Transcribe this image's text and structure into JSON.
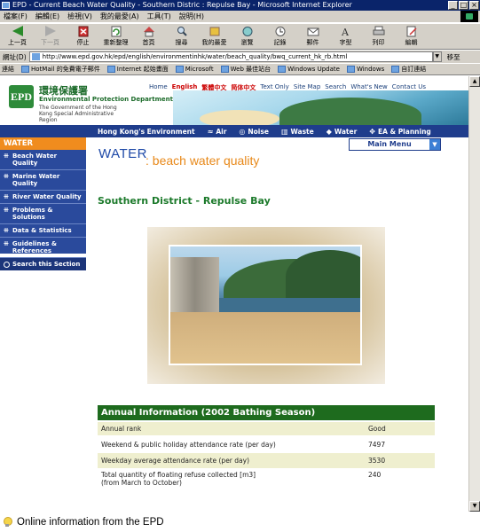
{
  "window": {
    "title": "EPD - Current Beach Water Quality - Southern Distric : Repulse Bay - Microsoft Internet Explorer",
    "buttons": [
      "_",
      "□",
      "×"
    ]
  },
  "menubar": [
    "檔案(F)",
    "編輯(E)",
    "檢視(V)",
    "我的最愛(A)",
    "工具(T)",
    "說明(H)"
  ],
  "toolbar": [
    {
      "label": "上一頁",
      "icon": "back-arrow-icon",
      "enabled": true
    },
    {
      "label": "下一頁",
      "icon": "forward-arrow-icon",
      "enabled": false
    },
    {
      "label": "停止",
      "icon": "stop-icon",
      "enabled": true
    },
    {
      "label": "重新整理",
      "icon": "refresh-icon",
      "enabled": true
    },
    {
      "label": "首頁",
      "icon": "home-icon",
      "enabled": true
    },
    {
      "label": "搜尋",
      "icon": "search-icon",
      "enabled": true
    },
    {
      "label": "我的最愛",
      "icon": "favorites-icon",
      "enabled": true
    },
    {
      "label": "瀏覽",
      "icon": "history-icon",
      "enabled": true
    },
    {
      "label": "記錄",
      "icon": "history-log-icon",
      "enabled": true
    },
    {
      "label": "郵件",
      "icon": "mail-icon",
      "enabled": true
    },
    {
      "label": "字型",
      "icon": "font-icon",
      "enabled": true
    },
    {
      "label": "列印",
      "icon": "print-icon",
      "enabled": true
    },
    {
      "label": "編輯",
      "icon": "edit-icon",
      "enabled": true
    }
  ],
  "address": {
    "label": "網址(D)",
    "url": "http://www.epd.gov.hk/epd/english/environmentinhk/water/beach_quality/bwq_current_hk_rb.html",
    "go_label": "移至"
  },
  "links": {
    "label": "連結",
    "items": [
      "HotMail 的免費電子郵件",
      "Internet 起始畫面",
      "Microsoft",
      "Web 最佳站台",
      "Windows Update",
      "Windows",
      "自訂連結"
    ]
  },
  "header": {
    "logo_text": "EPD",
    "name_cn": "環境保護署",
    "name_en": "Environmental Protection Department",
    "gov_text": "The Government of the Hong Kong Special Administrative Region",
    "top_links": [
      "Home",
      "English",
      "繁體中文",
      "简体中文",
      "Text Only",
      "Site Map",
      "Search",
      "What's New",
      "Contact Us"
    ]
  },
  "navbar": {
    "lead": "Hong Kong's Environment",
    "items": [
      "Air",
      "Noise",
      "Waste",
      "Water",
      "EA & Planning"
    ]
  },
  "sidebar": {
    "heading": "WATER",
    "items": [
      "Beach Water Quality",
      "Marine Water Quality",
      "River Water Quality",
      "Problems & Solutions",
      "Data & Statistics",
      "Guidelines & References"
    ],
    "search_label": "Search this Section"
  },
  "main_menu": {
    "label": "Main Menu"
  },
  "section": {
    "title": "WATER",
    "subtitle": "beach water quality"
  },
  "beach": {
    "name": "Southern District - Repulse Bay"
  },
  "annual": {
    "heading": "Annual Information (2002 Bathing Season)",
    "rows": [
      {
        "label": "Annual rank",
        "value": "Good"
      },
      {
        "label": "Weekend & public holiday attendance rate (per day)",
        "value": "7497"
      },
      {
        "label": "Weekday average attendance rate (per day)",
        "value": "3530"
      },
      {
        "label": "Total quantity of floating refuse collected [m3]",
        "label2": "(from March to October)",
        "value": "240"
      }
    ]
  },
  "caption": "Online information from the EPD",
  "colors": {
    "title_bar": "#0a246a",
    "nav_blue": "#1f3d8c",
    "sidebar_orange": "#f08c1e",
    "green": "#1e6b1e",
    "table_shade": "#efefcf"
  }
}
